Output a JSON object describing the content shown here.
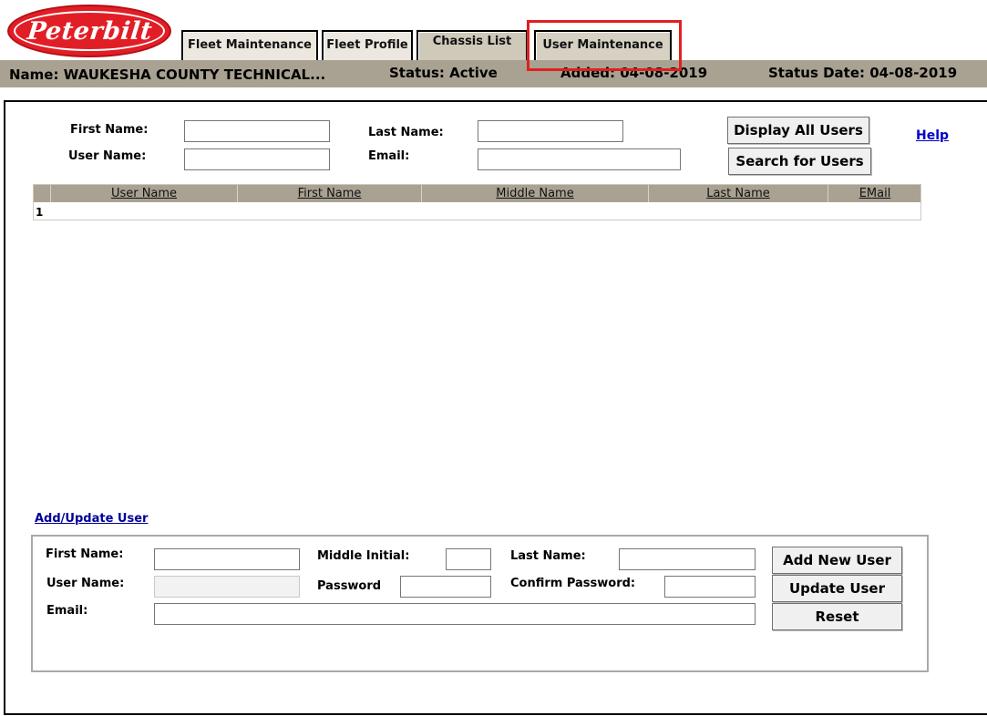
{
  "logo": {
    "text": "Peterbilt"
  },
  "tabs": [
    {
      "label": "Fleet Maintenance"
    },
    {
      "label": "Fleet Profile"
    },
    {
      "label": "Chassis List"
    },
    {
      "label": "User Maintenance"
    }
  ],
  "header": {
    "name": "Name: WAUKESHA COUNTY TECHNICAL...",
    "status": "Status: Active",
    "added": "Added: 04-08-2019",
    "status_date": "Status Date: 04-08-2019"
  },
  "search": {
    "first_name_label": "First Name:",
    "last_name_label": "Last Name:",
    "user_name_label": "User Name:",
    "email_label": "Email:",
    "first_name_value": "",
    "last_name_value": "",
    "user_name_value": "",
    "email_value": "",
    "display_all_label": "Display All Users",
    "search_label": "Search for Users",
    "help_label": "Help"
  },
  "grid": {
    "columns": [
      "User Name",
      "First Name",
      "Middle Name",
      "Last Name",
      "EMail"
    ],
    "rows": [
      {
        "index": "1"
      }
    ]
  },
  "add_update": {
    "section_link": "Add/Update User",
    "first_name_label": "First Name:",
    "middle_initial_label": "Middle Initial:",
    "last_name_label": "Last Name:",
    "user_name_label": "User Name:",
    "password_label": "Password",
    "confirm_password_label": "Confirm Password:",
    "email_label": "Email:",
    "add_button": "Add New User",
    "update_button": "Update User",
    "reset_button": "Reset"
  },
  "colors": {
    "brand_red": "#e11e26",
    "header_bar": "#a9a292",
    "highlight": "#e02020",
    "link": "#0000cc"
  }
}
